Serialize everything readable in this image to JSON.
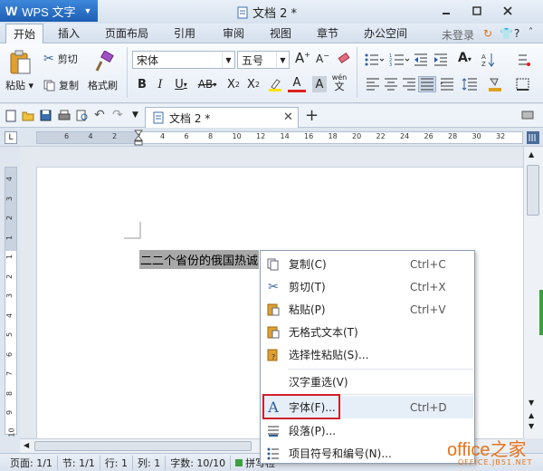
{
  "app": {
    "title": "WPS 文字",
    "doc_title": "文档 2 *"
  },
  "menu": {
    "tabs": [
      "开始",
      "插入",
      "页面布局",
      "引用",
      "审阅",
      "视图",
      "章节",
      "办公空间"
    ],
    "active": "开始",
    "login": "未登录"
  },
  "ribbon": {
    "paste": "粘贴",
    "cut": "剪切",
    "copy": "复制",
    "format_painter": "格式刷",
    "font_name": "宋体",
    "font_size": "五号",
    "grow_font": "A",
    "shrink_font": "A",
    "bold": "B",
    "italic": "I",
    "underline": "U",
    "strike": "AB",
    "superscript": "X",
    "subscript": "X",
    "sup_mark": "2",
    "sub_mark": "2",
    "font_color": "A",
    "char_shading": "A",
    "phonetic": "wén",
    "phonetic_char": "文",
    "font_color_hex": "#e02020",
    "highlight_hex": "#ffe000"
  },
  "tab": {
    "doc_name": "文档 2 *"
  },
  "ruler": {
    "h_ticks": [
      "6",
      "4",
      "2",
      "2",
      "4",
      "6",
      "8",
      "10",
      "12",
      "14",
      "16",
      "18",
      "20",
      "22",
      "24",
      "26",
      "28",
      "30",
      "32"
    ],
    "v_ticks": [
      "4",
      "3",
      "2",
      "1",
      "1",
      "2",
      "3",
      "4",
      "5",
      "6",
      "7",
      "8",
      "9",
      "10"
    ]
  },
  "document": {
    "selected_text": "二二个省份的俄国热诚"
  },
  "context_menu": {
    "items": [
      {
        "icon": "copy-icon",
        "label": "复制(C)",
        "shortcut": "Ctrl+C"
      },
      {
        "icon": "cut-icon",
        "label": "剪切(T)",
        "shortcut": "Ctrl+X"
      },
      {
        "icon": "paste-icon",
        "label": "粘贴(P)",
        "shortcut": "Ctrl+V"
      },
      {
        "icon": "",
        "label": "无格式文本(T)",
        "shortcut": ""
      },
      {
        "icon": "paste-special-icon",
        "label": "选择性粘贴(S)...",
        "shortcut": ""
      },
      {
        "icon": "",
        "label": "汉字重选(V)",
        "shortcut": ""
      },
      {
        "icon": "font-icon",
        "label": "字体(F)...",
        "shortcut": "Ctrl+D"
      },
      {
        "icon": "paragraph-icon",
        "label": "段落(P)...",
        "shortcut": ""
      },
      {
        "icon": "bullets-icon",
        "label": "项目符号和编号(N)...",
        "shortcut": ""
      }
    ],
    "highlighted_index": 6,
    "highlight_color": "#d0202a"
  },
  "status": {
    "page": "页面: 1/1",
    "section": "节: 1/1",
    "row": "行: 1",
    "col": "列: 1",
    "words": "字数: 10/10",
    "spell": "拼写检"
  },
  "watermark": {
    "text": "office之家",
    "url": "OFFICE.JB51.NET"
  }
}
